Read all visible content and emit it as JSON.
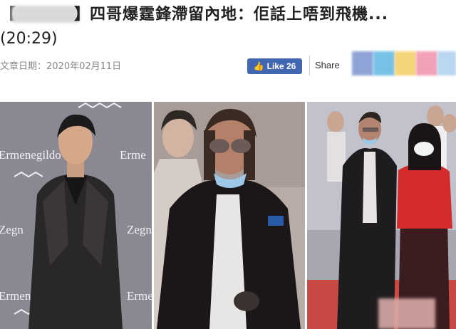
{
  "article": {
    "bracket_open": "【",
    "bracket_close": "】",
    "headline": "四哥爆霆鋒滯留內地：佢話上唔到飛機...",
    "duration": "(20:29)",
    "date_label": "文章日期：2020年02月11日"
  },
  "social": {
    "like_label": "Like 26",
    "share_label": "Share",
    "share_icon_colors": [
      "#8fa3d6",
      "#76c1e6",
      "#f6d57a",
      "#f3a1b8",
      "#b9d7f0"
    ]
  },
  "photos": [
    {
      "name": "photo-man-suit-ermenegildo-backdrop"
    },
    {
      "name": "photo-man-sunglasses-fur-coat"
    },
    {
      "name": "photo-couple-red-carpet"
    }
  ]
}
